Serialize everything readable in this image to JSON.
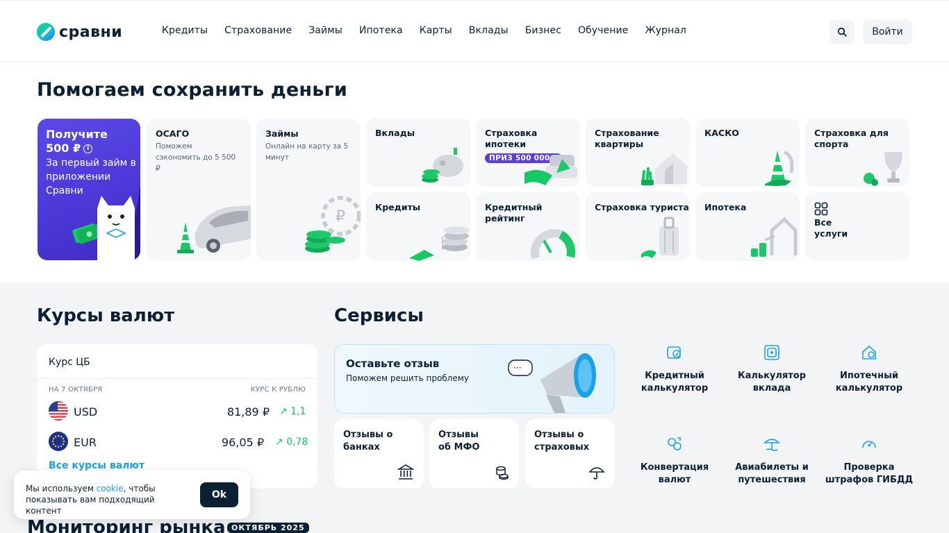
{
  "header": {
    "logo_text": "сравни",
    "nav": [
      "Кредиты",
      "Страхование",
      "Займы",
      "Ипотека",
      "Карты",
      "Вклады",
      "Бизнес",
      "Обучение",
      "Журнал"
    ],
    "login_label": "Войти"
  },
  "hero": {
    "title": "Помогаем сохранить деньги",
    "promo": {
      "title": "Получите 500 ₽",
      "subtitle": "За первый займ в приложении Сравни"
    },
    "tiles": {
      "osago": {
        "title": "ОСАГО",
        "subtitle": "Поможем сэкономить до 5 500 ₽"
      },
      "zaimy": {
        "title": "Займы",
        "subtitle": "Онлайн на карту за 5 минут"
      },
      "vklady": {
        "title": "Вклады"
      },
      "mortgage_ins": {
        "title": "Страховка ипотеки",
        "badge": "ПРИЗ 500 000 ₽"
      },
      "flat_ins": {
        "title": "Страхование квартиры"
      },
      "kasko": {
        "title": "КАСКО"
      },
      "sport_ins": {
        "title": "Страховка для спорта"
      },
      "credits": {
        "title": "Кредиты"
      },
      "credit_rating": {
        "title": "Кредитный рейтинг"
      },
      "tourist_ins": {
        "title": "Страховка туриста"
      },
      "ipoteka": {
        "title": "Ипотека"
      },
      "all": {
        "title": "Все услуги"
      }
    }
  },
  "fx": {
    "title": "Курсы валют",
    "card_title": "Курс ЦБ",
    "date_label": "НА 7 ОКТЯБРЯ",
    "rate_label": "КУРС К РУБЛЮ",
    "rows": [
      {
        "code": "USD",
        "value": "81,89 ₽",
        "delta": "1,1"
      },
      {
        "code": "EUR",
        "value": "96,05 ₽",
        "delta": "0,78"
      }
    ],
    "link": "Все курсы валют",
    "colors": {
      "up": "#12c46b",
      "link": "#1aa2e8"
    }
  },
  "services": {
    "title": "Сервисы",
    "review": {
      "title": "Оставьте отзыв",
      "subtitle": "Поможем решить проблему"
    },
    "review_tiles": [
      "Отзывы о банках",
      "Отзывы об МФО",
      "Отзывы о страховых"
    ],
    "items": [
      "Кредитный калькулятор",
      "Калькулятор вклада",
      "Ипотечный калькулятор",
      "Конвертация валют",
      "Авиабилеты и путешествия",
      "Проверка штрафов ГИБДД"
    ],
    "icon_color": "#1aa2e8"
  },
  "cookie": {
    "text_before": "Мы используем ",
    "link": "cookie",
    "text_after": ", чтобы показывать вам подходящий контент",
    "ok": "Ok"
  },
  "monitoring": {
    "title": "Мониторинг рынка",
    "badge": "ОКТЯБРЬ 2025"
  }
}
